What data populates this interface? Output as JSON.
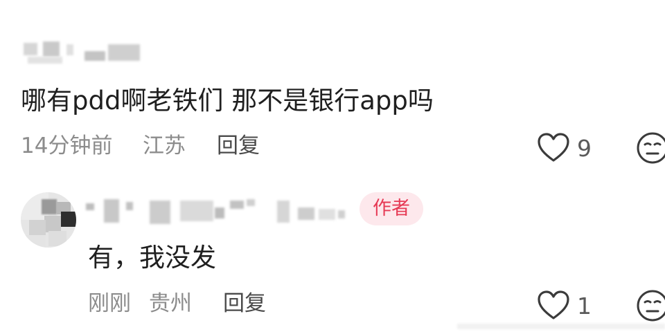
{
  "comments": [
    {
      "text": "哪有pdd啊老铁们 那不是银行app吗",
      "time": "14分钟前",
      "location": "江苏",
      "reply_label": "回复",
      "like_count": "9"
    },
    {
      "badge": "作者",
      "text": "有，我没发",
      "time": "刚刚",
      "location": "贵州",
      "reply_label": "回复",
      "like_count": "1"
    }
  ],
  "icons": {
    "like": "heart-outline-icon",
    "dislike": "neutral-face-icon"
  },
  "colors": {
    "badge_bg": "#fde8ec",
    "badge_text": "#e63a55",
    "meta_text": "#8c8c8c"
  }
}
